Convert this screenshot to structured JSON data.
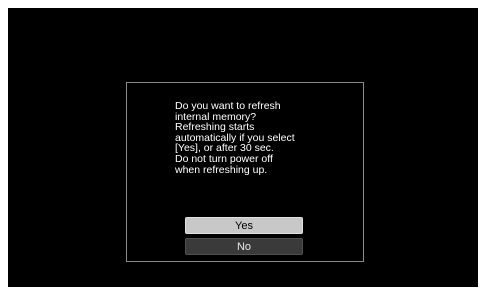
{
  "dialog": {
    "message_lines": [
      "Do you want to refresh",
      "internal memory?",
      "Refreshing starts",
      "automatically if you select",
      "[Yes], or after 30 sec.",
      "Do not turn power off",
      "when refreshing up."
    ],
    "yes_label": "Yes",
    "no_label": "No",
    "selected_option": "Yes"
  },
  "colors": {
    "screen_background": "#000000",
    "dialog_border": "#8a8a8a",
    "text": "#ffffff",
    "selected_button": "#c8c8c8",
    "unselected_button": "#3a3a3a"
  }
}
